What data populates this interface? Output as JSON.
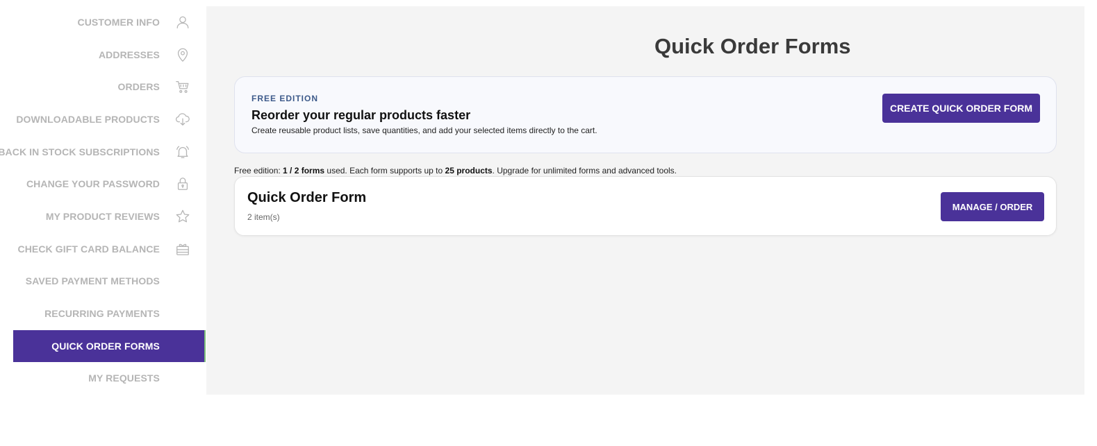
{
  "sidebar": {
    "items": [
      {
        "label": "CUSTOMER INFO",
        "icon": "user-icon"
      },
      {
        "label": "ADDRESSES",
        "icon": "map-pin-icon"
      },
      {
        "label": "ORDERS",
        "icon": "cart-icon"
      },
      {
        "label": "DOWNLOADABLE PRODUCTS",
        "icon": "cloud-download-icon"
      },
      {
        "label": "BACK IN STOCK SUBSCRIPTIONS",
        "icon": "bell-icon"
      },
      {
        "label": "CHANGE YOUR PASSWORD",
        "icon": "lock-icon"
      },
      {
        "label": "MY PRODUCT REVIEWS",
        "icon": "star-icon"
      },
      {
        "label": "CHECK GIFT CARD BALANCE",
        "icon": "gift-icon"
      },
      {
        "label": "SAVED PAYMENT METHODS",
        "icon": ""
      },
      {
        "label": "RECURRING PAYMENTS",
        "icon": ""
      },
      {
        "label": "QUICK ORDER FORMS",
        "icon": "",
        "active": true
      },
      {
        "label": "MY REQUESTS",
        "icon": ""
      }
    ]
  },
  "main": {
    "title": "Quick Order Forms",
    "promo": {
      "eyebrow": "FREE EDITION",
      "headline": "Reorder your regular products faster",
      "description": "Create reusable product lists, save quantities, and add your selected items directly to the cart.",
      "create_button": "CREATE QUICK ORDER FORM"
    },
    "usage": {
      "prefix": "Free edition: ",
      "forms_used": "1 / 2 forms",
      "middle": " used. Each form supports up to ",
      "product_limit": "25 products",
      "suffix": ". Upgrade for unlimited forms and advanced tools."
    },
    "forms": [
      {
        "name": "Quick Order Form",
        "count": "2 item(s)",
        "button": "MANAGE / ORDER"
      }
    ]
  },
  "colors": {
    "accent": "#4a3299",
    "sidebar_text": "#b5b5b5",
    "active_indicator": "#7ec07a",
    "main_bg": "#f4f4f4"
  }
}
